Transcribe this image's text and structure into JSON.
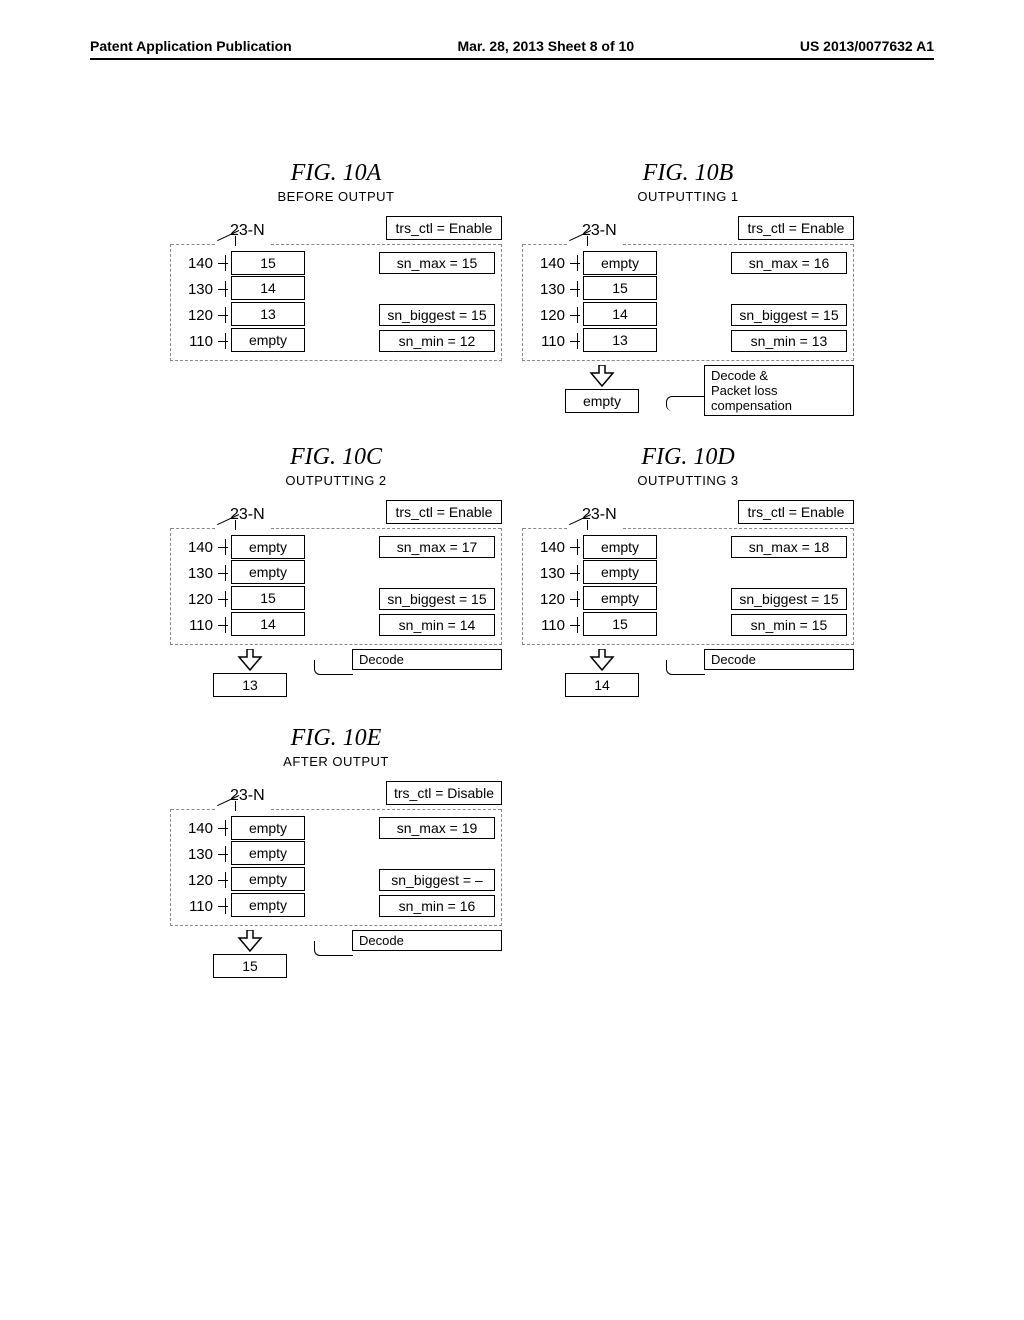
{
  "header": {
    "left": "Patent Application Publication",
    "center": "Mar. 28, 2013  Sheet 8 of 10",
    "right": "US 2013/0077632 A1"
  },
  "ref_label": "23-N",
  "row_labels": [
    "140",
    "130",
    "120",
    "110"
  ],
  "figs": {
    "A": {
      "title": "FIG. 10A",
      "sub": "BEFORE OUTPUT",
      "trs": "trs_ctl = Enable",
      "cells": [
        "15",
        "14",
        "13",
        "empty"
      ],
      "sn_max": "sn_max = 15",
      "sn_biggest": "sn_biggest = 15",
      "sn_min": "sn_min = 12",
      "out": null,
      "decode": null
    },
    "B": {
      "title": "FIG. 10B",
      "sub": "OUTPUTTING 1",
      "trs": "trs_ctl = Enable",
      "cells": [
        "empty",
        "15",
        "14",
        "13"
      ],
      "sn_max": "sn_max = 16",
      "sn_biggest": "sn_biggest = 15",
      "sn_min": "sn_min = 13",
      "out": "empty",
      "decode": "Decode &\nPacket loss\ncompensation"
    },
    "C": {
      "title": "FIG. 10C",
      "sub": "OUTPUTTING 2",
      "trs": "trs_ctl = Enable",
      "cells": [
        "empty",
        "empty",
        "15",
        "14"
      ],
      "sn_max": "sn_max = 17",
      "sn_biggest": "sn_biggest = 15",
      "sn_min": "sn_min = 14",
      "out": "13",
      "decode": "Decode"
    },
    "D": {
      "title": "FIG. 10D",
      "sub": "OUTPUTTING 3",
      "trs": "trs_ctl = Enable",
      "cells": [
        "empty",
        "empty",
        "empty",
        "15"
      ],
      "sn_max": "sn_max = 18",
      "sn_biggest": "sn_biggest = 15",
      "sn_min": "sn_min = 15",
      "out": "14",
      "decode": "Decode"
    },
    "E": {
      "title": "FIG. 10E",
      "sub": "AFTER OUTPUT",
      "trs": "trs_ctl = Disable",
      "cells": [
        "empty",
        "empty",
        "empty",
        "empty"
      ],
      "sn_max": "sn_max = 19",
      "sn_biggest": "sn_biggest =  –",
      "sn_min": "sn_min = 16",
      "out": "15",
      "decode": "Decode"
    }
  }
}
